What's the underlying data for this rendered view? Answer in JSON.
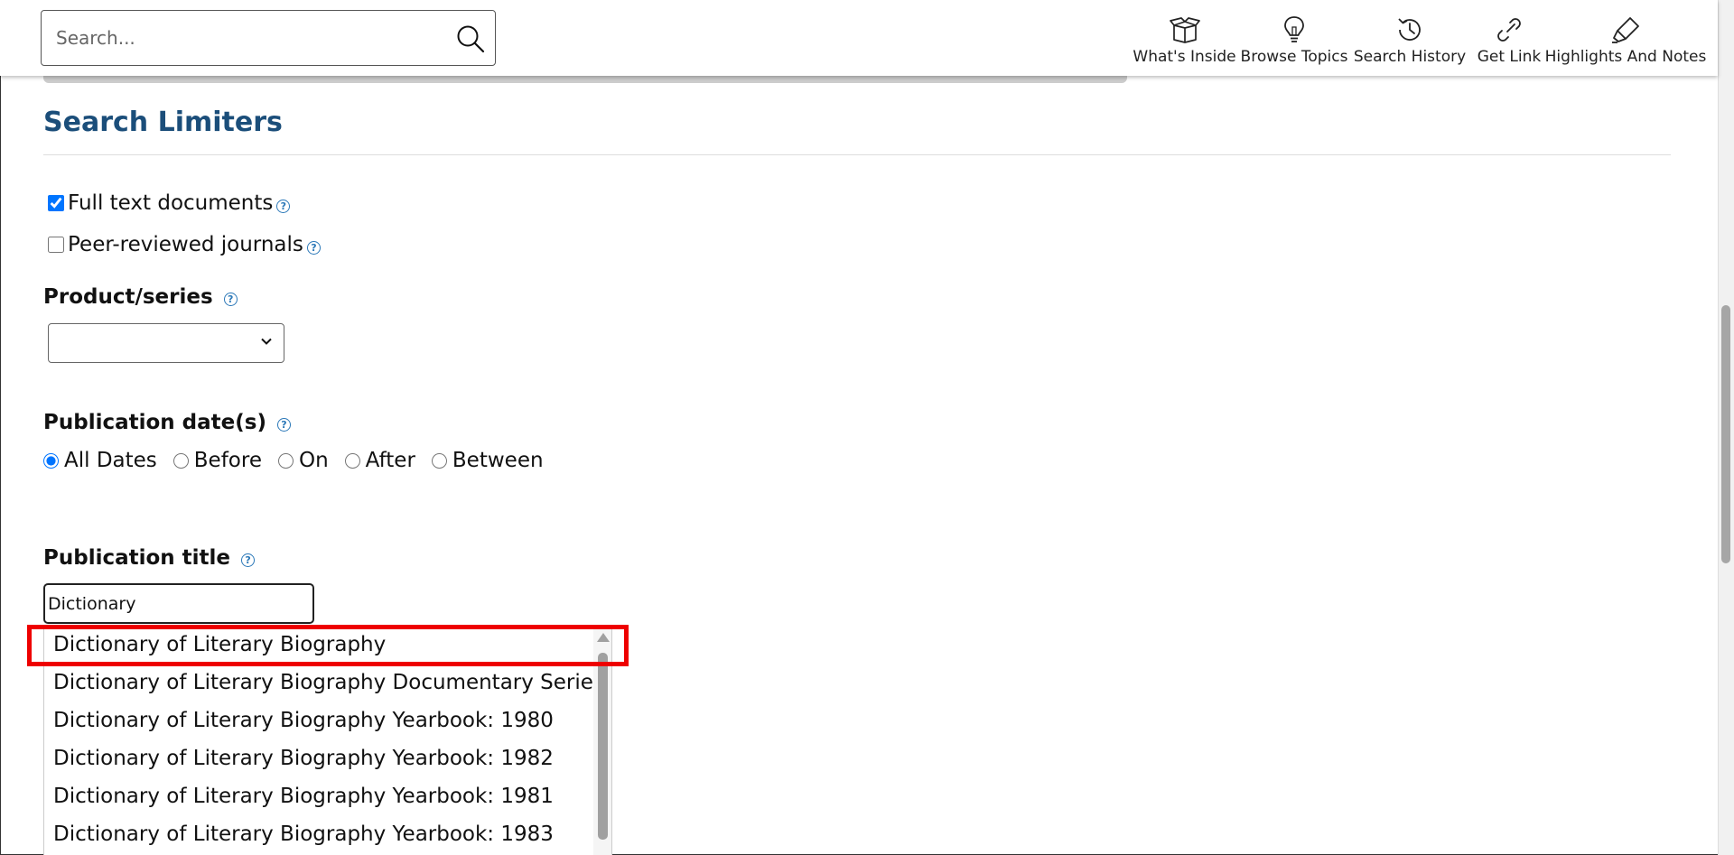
{
  "search": {
    "placeholder": "Search..."
  },
  "toolbar": {
    "items": [
      {
        "label": "What's Inside",
        "icon": "open-box-icon"
      },
      {
        "label": "Browse Topics",
        "icon": "lightbulb-icon"
      },
      {
        "label": "Search History",
        "icon": "history-icon"
      },
      {
        "label": "Get Link",
        "icon": "link-icon"
      },
      {
        "label": "Highlights And Notes",
        "icon": "highlighter-icon"
      }
    ]
  },
  "limiters": {
    "section_title": "Search Limiters",
    "full_text": {
      "label": "Full text documents",
      "checked": true
    },
    "peer_reviewed": {
      "label": "Peer-reviewed journals",
      "checked": false
    },
    "product_series": {
      "label": "Product/series",
      "value": ""
    },
    "publication_dates": {
      "label": "Publication date(s)",
      "options": [
        "All Dates",
        "Before",
        "On",
        "After",
        "Between"
      ],
      "selected": "All Dates"
    },
    "publication_title": {
      "label": "Publication title",
      "value": "Dictionary",
      "suggestions": [
        "Dictionary of Literary Biography",
        "Dictionary of Literary Biography Documentary Series",
        "Dictionary of Literary Biography Yearbook: 1980",
        "Dictionary of Literary Biography Yearbook: 1982",
        "Dictionary of Literary Biography Yearbook: 1981",
        "Dictionary of Literary Biography Yearbook: 1983"
      ]
    }
  },
  "help_glyph": "?",
  "colors": {
    "heading": "#1b4e7a",
    "help": "#2b78b8",
    "highlight": "#ee0000"
  }
}
